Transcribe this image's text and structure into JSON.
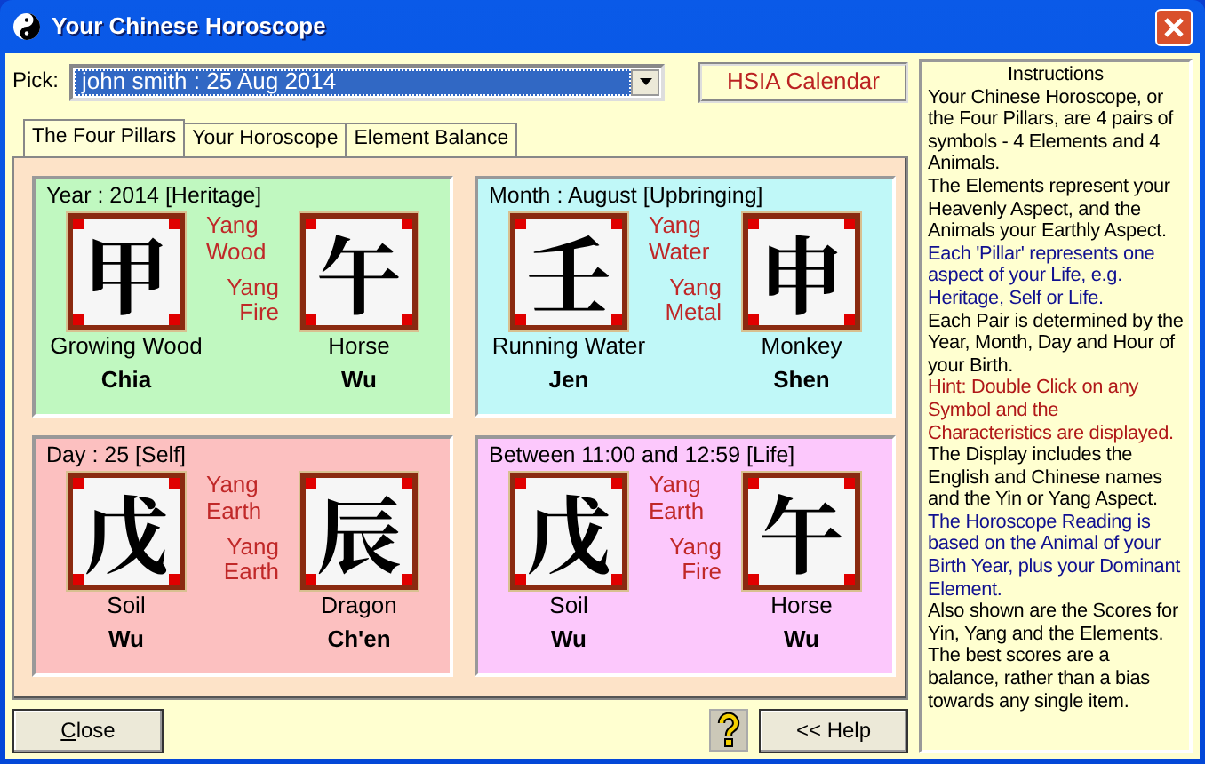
{
  "window": {
    "title": "Your Chinese Horoscope"
  },
  "pick": {
    "label": "Pick:",
    "value": "john smith : 25 Aug 2014"
  },
  "calendar_label": "HSIA Calendar",
  "tabs": [
    {
      "label": "The Four Pillars",
      "selected": true
    },
    {
      "label": "Your Horoscope",
      "selected": false
    },
    {
      "label": "Element Balance",
      "selected": false
    }
  ],
  "pillars": [
    {
      "title": "Year : 2014 [Heritage]",
      "color": "#c0f8c0",
      "stem": {
        "char": "甲",
        "aspect": "Yang Wood",
        "english": "Growing Wood",
        "pinyin": "Chia"
      },
      "branch": {
        "char": "午",
        "aspect": "Yang Fire",
        "english": "Horse",
        "pinyin": "Wu"
      }
    },
    {
      "title": "Month : August [Upbringing]",
      "color": "#c0f8f8",
      "stem": {
        "char": "壬",
        "aspect": "Yang Water",
        "english": "Running Water",
        "pinyin": "Jen"
      },
      "branch": {
        "char": "申",
        "aspect": "Yang Metal",
        "english": "Monkey",
        "pinyin": "Shen"
      }
    },
    {
      "title": "Day : 25 [Self]",
      "color": "#fcc0c0",
      "stem": {
        "char": "戊",
        "aspect": "Yang Earth",
        "english": "Soil",
        "pinyin": "Wu"
      },
      "branch": {
        "char": "辰",
        "aspect": "Yang Earth",
        "english": "Dragon",
        "pinyin": "Ch'en"
      }
    },
    {
      "title": "Between 11:00 and 12:59 [Life]",
      "color": "#fcc8fc",
      "stem": {
        "char": "戊",
        "aspect": "Yang Earth",
        "english": "Soil",
        "pinyin": "Wu"
      },
      "branch": {
        "char": "午",
        "aspect": "Yang Fire",
        "english": "Horse",
        "pinyin": "Wu"
      }
    }
  ],
  "instructions": {
    "title": "Instructions",
    "paragraphs": [
      {
        "text": "Your Chinese Horoscope, or the Four Pillars, are 4 pairs of symbols - 4 Elements and 4 Animals.",
        "color": "#000000"
      },
      {
        "text": "The Elements represent your Heavenly Aspect, and the Animals your Earthly Aspect.",
        "color": "#000000"
      },
      {
        "text": "Each 'Pillar' represents one aspect of your Life, e.g. Heritage, Self or Life.",
        "color": "#101090"
      },
      {
        "text": "Each Pair is determined by the Year, Month, Day and Hour of your Birth.",
        "color": "#000000"
      },
      {
        "text": "Hint: Double Click on any Symbol and the Characteristics are displayed.",
        "color": "#b01818"
      },
      {
        "text": "The Display includes the English and Chinese names and the Yin or Yang Aspect.",
        "color": "#000000"
      },
      {
        "text": "The Horoscope Reading is based on the Animal of your Birth Year, plus your Dominant Element.",
        "color": "#101090"
      },
      {
        "text": "Also shown are the Scores for Yin, Yang and the Elements. The best scores are a balance, rather than a bias towards any single item.",
        "color": "#000000"
      }
    ]
  },
  "buttons": {
    "close": "Close",
    "help": "<< Help"
  }
}
